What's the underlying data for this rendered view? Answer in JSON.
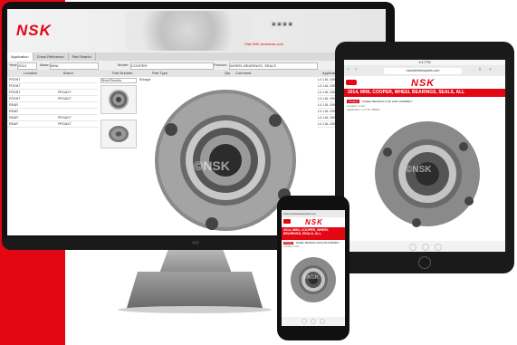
{
  "brand": {
    "logo": "NSK",
    "accent": "#e30613"
  },
  "desktop": {
    "header_link": "Visit NSK Americas.com",
    "tabs": [
      "Application",
      "Cross Reference",
      "Part Search"
    ],
    "filters": {
      "year_label": "Year:",
      "year_value": "2014",
      "make_label": "Make:",
      "make_value": "MINI",
      "model_label": "Model:",
      "model_value": "COOPER",
      "product_label": "Product:",
      "product_value": "WHEEL BEARINGS, SEALS",
      "engine_label": "Engine:"
    },
    "columns": [
      "Location",
      "Brand",
      "Part Number",
      "Part Type",
      "Qty",
      "Comment",
      "Application"
    ],
    "rows": [
      {
        "location": "FRONT",
        "brand": ""
      },
      {
        "location": "FRONT",
        "brand": ""
      },
      {
        "location": "FRONT",
        "brand": "PROAXT"
      },
      {
        "location": "FRONT",
        "brand": "PROAXT"
      },
      {
        "location": "REAR",
        "brand": ""
      },
      {
        "location": "REAR",
        "brand": ""
      },
      {
        "location": "REAR",
        "brand": "PROAXT"
      },
      {
        "location": "REAR",
        "brand": "PROAXT"
      }
    ],
    "image_panel_label": "Enlarge",
    "thumb_label": "ShowThumbs",
    "applications": [
      "L4 1.6L 1598cc",
      "L4 1.6L 1598cc",
      "L4 1.6L 1598cc",
      "L4 1.6L 1598cc",
      "L4 1.6L 1598cc",
      "L4 1.6L 1598cc",
      "L4 1.6L 1598cc",
      "L4 1.6L 1598cc"
    ],
    "watermark": "©NSK"
  },
  "tablet": {
    "status_time": "9:47 PM",
    "url": "nskwheelbearparts.com",
    "title": "2014, MINI, COOPER, WHEEL BEARINGS, SEALS, ALL",
    "part_tag": "Product",
    "part_line": "WHEEL BEARING AND HUB ASSEMBLY",
    "detail_line_1": "Location: Front",
    "detail_line_2": "Application: L4 1.6L 1598cc",
    "watermark": "©NSK"
  },
  "phone": {
    "url": "www.nskwheelbearparts.com",
    "title": "2014, MINI, COOPER, WHEEL BEARINGS, SEALS, ALL",
    "part_tag": "Product",
    "part_line": "WHEEL BEARING AND HUB ASSEMBLY",
    "detail_line_1": "Location: Front",
    "watermark": "©NSK"
  }
}
